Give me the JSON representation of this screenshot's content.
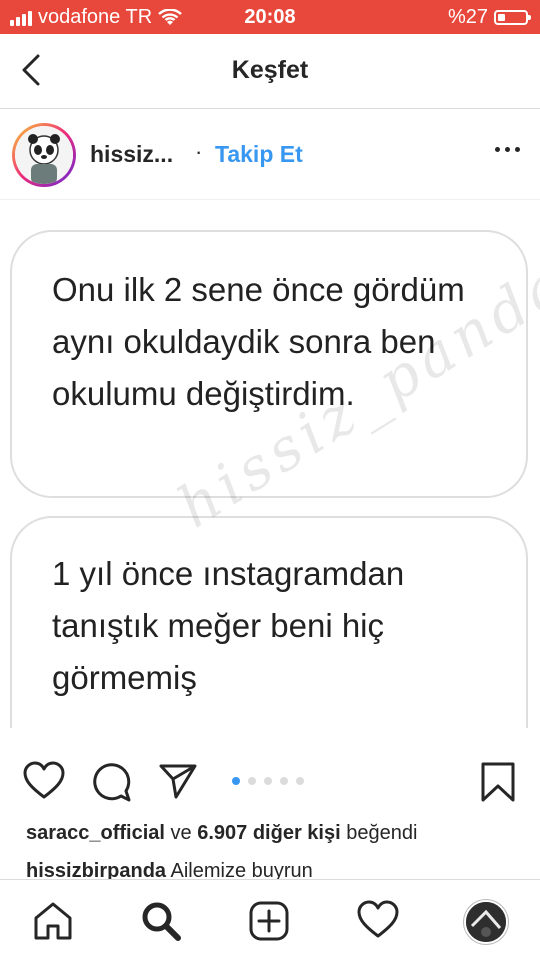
{
  "status": {
    "carrier": "vodafone TR",
    "time": "20:08",
    "battery": "%27",
    "battery_level": 0.27
  },
  "nav": {
    "title": "Keşfet"
  },
  "post": {
    "username": "hissiz...",
    "dot": "·",
    "follow_label": "Takip Et",
    "bubble1": "Onu ilk 2 sene önce gördüm aynı okuldaydik sonra ben okulumu değiştirdim.",
    "bubble2": "1 yıl önce ınstagramdan tanıştık meğer beni hiç görmemiş",
    "watermark": "hissiz_panda",
    "carousel": {
      "count": 5,
      "active": 1
    }
  },
  "likes": {
    "user": "saracc_official",
    "connector": "ve",
    "count": "6.907 diğer kişi",
    "suffix": "beğendi"
  },
  "caption": {
    "user": "hissizbirpanda",
    "text": "Ailemize buyrun"
  },
  "icons": {
    "back": "chevron-left-icon",
    "heart": "heart-icon",
    "comment": "comment-icon",
    "share": "send-icon",
    "bookmark": "bookmark-icon",
    "home": "home-icon",
    "search": "search-icon",
    "add": "plus-square-icon",
    "activity": "heart-icon",
    "profile": "avatar"
  },
  "colors": {
    "statusbar": "#e8483b",
    "link": "#3897f0",
    "active_dot": "#3897f0"
  }
}
